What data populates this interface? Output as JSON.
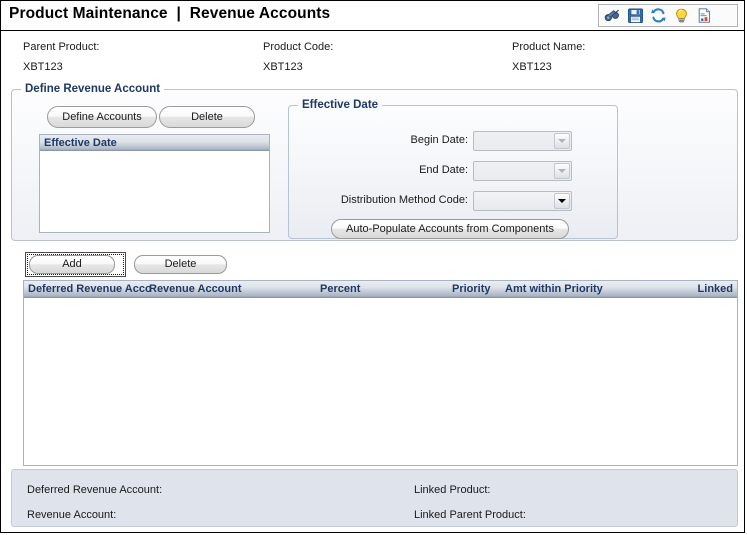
{
  "window": {
    "title": "Product Maintenance  |  Revenue Accounts"
  },
  "toolbar": {
    "icons": [
      {
        "name": "binoculars-icon",
        "label": "Search"
      },
      {
        "name": "save-icon",
        "label": "Save"
      },
      {
        "name": "refresh-icon",
        "label": "Refresh"
      },
      {
        "name": "lightbulb-icon",
        "label": "Hint"
      },
      {
        "name": "report-icon",
        "label": "Report"
      }
    ]
  },
  "product_info": {
    "parent_product_label": "Parent Product:",
    "parent_product_value": "XBT123",
    "product_code_label": "Product Code:",
    "product_code_value": "XBT123",
    "product_name_label": "Product Name:",
    "product_name_value": "XBT123"
  },
  "define_revenue_account": {
    "legend": "Define Revenue Account",
    "define_accounts_button": "Define Accounts",
    "delete_button": "Delete",
    "list_header": "Effective Date",
    "list_rows": []
  },
  "effective_date": {
    "legend": "Effective Date",
    "begin_date_label": "Begin Date:",
    "begin_date_value": "",
    "end_date_label": "End Date:",
    "end_date_value": "",
    "distribution_method_label": "Distribution Method Code:",
    "distribution_method_value": "",
    "auto_populate_button": "Auto-Populate Accounts from Components"
  },
  "accounts_grid": {
    "add_button": "Add",
    "delete_button": "Delete",
    "columns": [
      {
        "label": "Deferred Revenue Acco",
        "align": "left"
      },
      {
        "label": "Revenue Account",
        "align": "left"
      },
      {
        "label": "Percent",
        "align": "right"
      },
      {
        "label": "Priority",
        "align": "right"
      },
      {
        "label": "Amt within Priority",
        "align": "left"
      },
      {
        "label": "Linked",
        "align": "right"
      }
    ],
    "rows": []
  },
  "detail_panel": {
    "deferred_revenue_account_label": "Deferred Revenue Account:",
    "deferred_revenue_account_value": "",
    "revenue_account_label": "Revenue Account:",
    "revenue_account_value": "",
    "linked_product_label": "Linked Product:",
    "linked_product_value": "",
    "linked_parent_product_label": "Linked Parent Product:",
    "linked_parent_product_value": ""
  },
  "colors": {
    "header_text": "#1f3864",
    "panel_border": "#b9c2d0",
    "grid_header_bottom": "#8f9cb1",
    "detail_bg": "#dfe3ec"
  }
}
